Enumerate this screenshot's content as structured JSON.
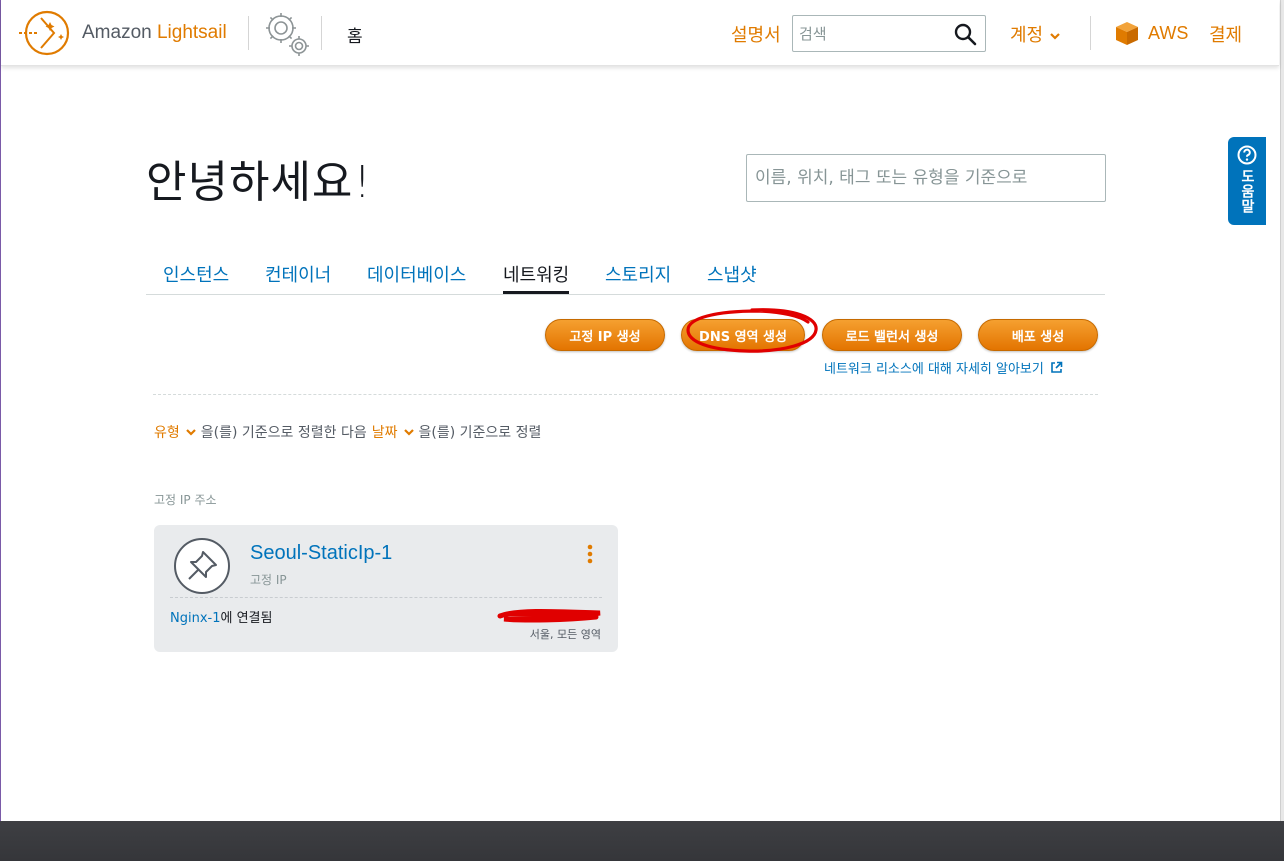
{
  "header": {
    "brand_prefix": "Amazon ",
    "brand_name": "Lightsail",
    "home": "홈",
    "docs": "설명서",
    "search_placeholder": "검색",
    "account": "계정",
    "aws": "AWS",
    "billing": "결제"
  },
  "help": {
    "label": "도움말"
  },
  "greeting": "안녕하세요!",
  "filter_placeholder": "이름, 위치, 태그 또는 유형을 기준으로",
  "tabs": [
    {
      "label": "인스턴스"
    },
    {
      "label": "컨테이너"
    },
    {
      "label": "데이터베이스"
    },
    {
      "label": "네트워킹",
      "active": true
    },
    {
      "label": "스토리지"
    },
    {
      "label": "스냅샷"
    }
  ],
  "actions": {
    "create_static_ip": "고정 IP 생성",
    "create_dns_zone": "DNS 영역 생성",
    "create_load_balancer": "로드 밸런서 생성",
    "create_distribution": "배포 생성",
    "learn_more": "네트워크 리소스에 대해 자세히 알아보기"
  },
  "sort": {
    "key1": "유형",
    "mid1": "을(를) 기준으로 정렬한 다음",
    "key2": "날짜",
    "mid2": "을(를) 기준으로 정렬"
  },
  "section_label": "고정 IP 주소",
  "resource": {
    "name": "Seoul-StaticIp-1",
    "type": "고정 IP",
    "attached_to": "Nginx-1",
    "attached_suffix": "에 연결됨",
    "region": "서울, 모든 영역"
  },
  "colors": {
    "accent_orange": "#e07b00",
    "link_blue": "#0073bb",
    "annotation_red": "#e00000"
  }
}
